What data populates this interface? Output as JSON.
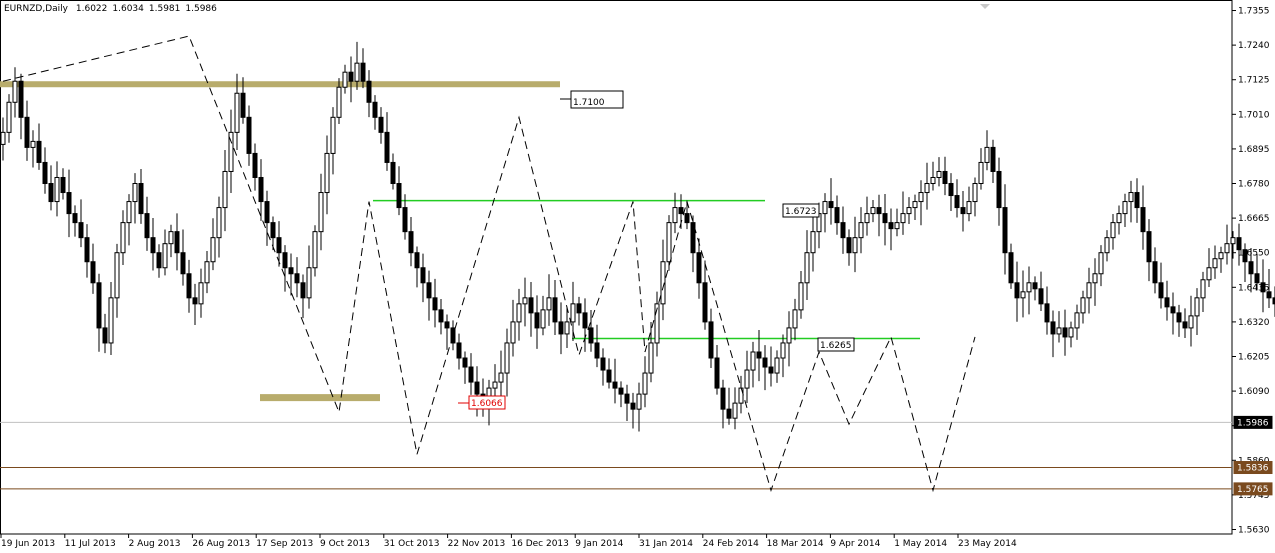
{
  "header": {
    "symbol": "EURNZD,Daily",
    "open": "1.6022",
    "high": "1.6034",
    "low": "1.5981",
    "close": "1.5986"
  },
  "colors": {
    "background": "#ffffff",
    "candle": "#000000",
    "zone": "#b8ac6c",
    "green_level": "#22cc22",
    "brown_level": "#7a4a1e",
    "red_label": "#e00000",
    "current_price_line": "#c0c0c0",
    "zigzag": "#000000"
  },
  "levels": {
    "zone_top_label": "1.7100",
    "green_upper_label": "1.6723",
    "green_lower_label": "1.6265",
    "red_label": "1.6066",
    "current_price_label": "1.5986",
    "brown_upper_label": "1.5836",
    "brown_lower_label": "1.5765"
  },
  "chart_data": {
    "type": "candlestick",
    "symbol": "EURNZD",
    "timeframe": "Daily",
    "ylim": [
      1.5615,
      1.738
    ],
    "y_ticks": [
      "1.7355",
      "1.7240",
      "1.7125",
      "1.7010",
      "1.6895",
      "1.6780",
      "1.6665",
      "1.6550",
      "1.6435",
      "1.6320",
      "1.6205",
      "1.6090",
      "1.5975",
      "1.5860",
      "1.5745",
      "1.5630"
    ],
    "x_ticks": [
      "19 Jun 2013",
      "11 Jul 2013",
      "2 Aug 2013",
      "26 Aug 2013",
      "17 Sep 2013",
      "9 Oct 2013",
      "31 Oct 2013",
      "22 Nov 2013",
      "16 Dec 2013",
      "9 Jan 2014",
      "31 Jan 2014",
      "24 Feb 2014",
      "18 Mar 2014",
      "9 Apr 2014",
      "1 May 2014",
      "23 May 2014"
    ],
    "closes": [
      1.695,
      1.705,
      1.712,
      1.7,
      1.69,
      1.692,
      1.685,
      1.678,
      1.672,
      1.68,
      1.675,
      1.668,
      1.665,
      1.66,
      1.652,
      1.645,
      1.63,
      1.625,
      1.64,
      1.655,
      1.665,
      1.672,
      1.678,
      1.668,
      1.66,
      1.655,
      1.65,
      1.658,
      1.662,
      1.655,
      1.648,
      1.64,
      1.638,
      1.645,
      1.652,
      1.66,
      1.67,
      1.682,
      1.695,
      1.708,
      1.7,
      1.688,
      1.68,
      1.672,
      1.665,
      1.66,
      1.655,
      1.65,
      1.648,
      1.645,
      1.64,
      1.65,
      1.662,
      1.675,
      1.688,
      1.7,
      1.71,
      1.715,
      1.712,
      1.718,
      1.712,
      1.705,
      1.7,
      1.695,
      1.685,
      1.678,
      1.67,
      1.662,
      1.655,
      1.65,
      1.645,
      1.64,
      1.636,
      1.632,
      1.63,
      1.625,
      1.62,
      1.617,
      1.612,
      1.608,
      1.605,
      1.61,
      1.612,
      1.615,
      1.625,
      1.632,
      1.638,
      1.64,
      1.635,
      1.63,
      1.636,
      1.64,
      1.632,
      1.628,
      1.632,
      1.638,
      1.635,
      1.63,
      1.625,
      1.62,
      1.616,
      1.612,
      1.61,
      1.608,
      1.605,
      1.603,
      1.608,
      1.615,
      1.625,
      1.638,
      1.652,
      1.665,
      1.67,
      1.668,
      1.665,
      1.655,
      1.645,
      1.632,
      1.62,
      1.61,
      1.603,
      1.6,
      1.605,
      1.61,
      1.616,
      1.622,
      1.62,
      1.617,
      1.615,
      1.62,
      1.625,
      1.63,
      1.636,
      1.645,
      1.655,
      1.662,
      1.668,
      1.672,
      1.67,
      1.665,
      1.66,
      1.655,
      1.66,
      1.665,
      1.668,
      1.67,
      1.668,
      1.665,
      1.663,
      1.665,
      1.668,
      1.67,
      1.672,
      1.675,
      1.678,
      1.68,
      1.682,
      1.678,
      1.674,
      1.67,
      1.668,
      1.672,
      1.678,
      1.685,
      1.69,
      1.682,
      1.67,
      1.655,
      1.645,
      1.64,
      1.642,
      1.645,
      1.643,
      1.638,
      1.632,
      1.628,
      1.63,
      1.627,
      1.63,
      1.635,
      1.64,
      1.645,
      1.648,
      1.655,
      1.66,
      1.665,
      1.668,
      1.672,
      1.675,
      1.67,
      1.662,
      1.652,
      1.645,
      1.64,
      1.637,
      1.635,
      1.632,
      1.63,
      1.634,
      1.64,
      1.646,
      1.65,
      1.653,
      1.655,
      1.658,
      1.66,
      1.656,
      1.652,
      1.648,
      1.645,
      1.642,
      1.64,
      1.638,
      1.636,
      1.633,
      1.63,
      1.627,
      1.625,
      1.622,
      1.62,
      1.616,
      1.612,
      1.608,
      1.602,
      1.595,
      1.588,
      1.585,
      1.595,
      1.605,
      1.612,
      1.605,
      1.598,
      1.595,
      1.6,
      1.605,
      1.608,
      1.6,
      1.595,
      1.59,
      1.592,
      1.596,
      1.6,
      1.605,
      1.61,
      1.614,
      1.612,
      1.608,
      1.605,
      1.61,
      1.615,
      1.62,
      1.624,
      1.626,
      1.62,
      1.612,
      1.606,
      1.6,
      1.596,
      1.594,
      1.59,
      1.586,
      1.582,
      1.58,
      1.585,
      1.59,
      1.594,
      1.596,
      1.598,
      1.596,
      1.593,
      1.596,
      1.6,
      1.603,
      1.605,
      1.603,
      1.6,
      1.598,
      1.5986
    ],
    "annotations": [
      {
        "type": "zone",
        "label": "1.7100",
        "start_index": 0,
        "end_index": 89,
        "price": 1.711
      },
      {
        "type": "zone",
        "label": "",
        "start_index": 42,
        "end_index": 62,
        "price": 1.607
      },
      {
        "type": "hline",
        "label": "1.6723",
        "start_index": 59,
        "end_index": 123,
        "price": 1.6723
      },
      {
        "type": "hline",
        "label": "1.6265",
        "start_index": 91,
        "end_index": 146,
        "price": 1.6265
      },
      {
        "type": "hline",
        "label": "1.5836",
        "full_width": true,
        "price": 1.5836
      },
      {
        "type": "hline",
        "label": "1.5765",
        "full_width": true,
        "price": 1.5765
      },
      {
        "type": "hline",
        "label": "1.5986",
        "full_width": true,
        "price": 1.5986,
        "current": true
      }
    ],
    "zigzag": [
      {
        "i": 0,
        "p": 1.712
      },
      {
        "i": 31,
        "p": 1.727
      },
      {
        "i": 56,
        "p": 1.602
      },
      {
        "i": 61,
        "p": 1.672
      },
      {
        "i": 69,
        "p": 1.588
      },
      {
        "i": 86,
        "p": 1.7
      },
      {
        "i": 96,
        "p": 1.621
      },
      {
        "i": 105,
        "p": 1.672
      },
      {
        "i": 107,
        "p": 1.622
      },
      {
        "i": 114,
        "p": 1.672
      },
      {
        "i": 128,
        "p": 1.576
      },
      {
        "i": 136,
        "p": 1.622
      },
      {
        "i": 141,
        "p": 1.598
      },
      {
        "i": 148,
        "p": 1.627
      },
      {
        "i": 155,
        "p": 1.576
      },
      {
        "i": 162,
        "p": 1.627
      }
    ]
  }
}
